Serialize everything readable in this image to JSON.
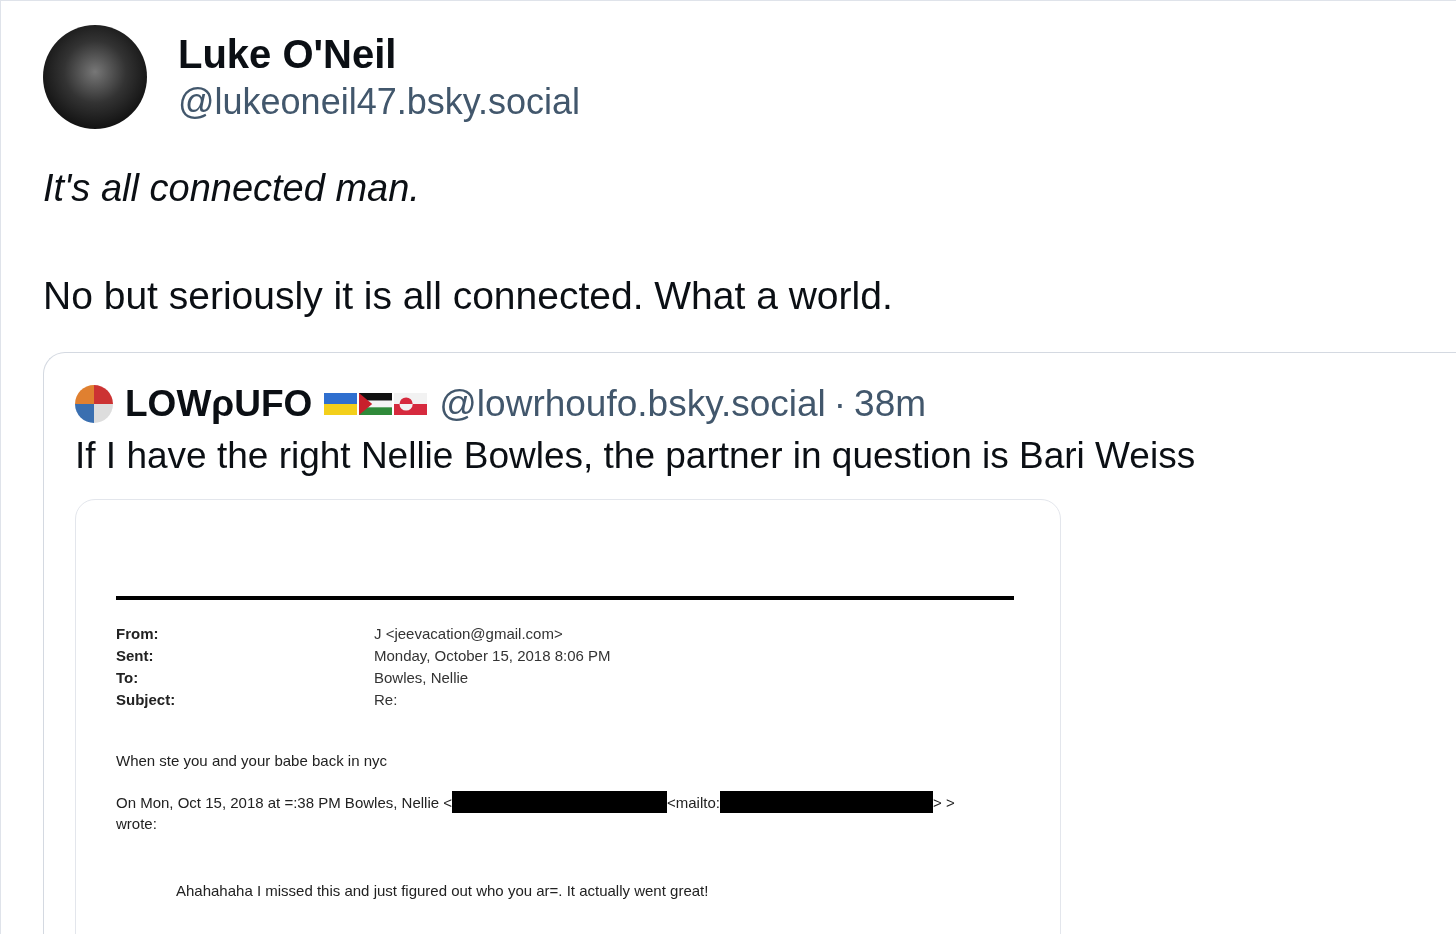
{
  "author": {
    "name": "Luke O'Neil",
    "handle": "@lukeoneil47.bsky.social"
  },
  "post": {
    "lead": "It's all connected man.",
    "text": "No but seriously it is all connected. What a world."
  },
  "quote": {
    "name": "LOWρUFO",
    "handle": "@lowrhoufo.bsky.social",
    "separator": "·",
    "time": "38m",
    "text": "If I have the right Nellie Bowles, the partner in question is Bari Weiss",
    "email": {
      "headers": [
        {
          "label": "From:",
          "value": "J <jeevacation@gmail.com>"
        },
        {
          "label": "Sent:",
          "value": "Monday, October 15, 2018 8:06 PM"
        },
        {
          "label": "To:",
          "value": "Bowles, Nellie"
        },
        {
          "label": "Subject:",
          "value": "Re:"
        }
      ],
      "body": "When ste you and your babe back in nyc",
      "quoted_line": [
        {
          "kind": "text",
          "text": "On Mon, Oct 15, 2018 at =:38 PM Bowles, Nellie <"
        },
        {
          "kind": "redacted"
        },
        {
          "kind": "text",
          "text": "<mailto:"
        },
        {
          "kind": "redacted"
        },
        {
          "kind": "text",
          "text": "> >"
        }
      ],
      "wrote": "wrote:",
      "reply": "Ahahahaha I missed this and just figured out who you ar=. It actually went great!"
    }
  }
}
